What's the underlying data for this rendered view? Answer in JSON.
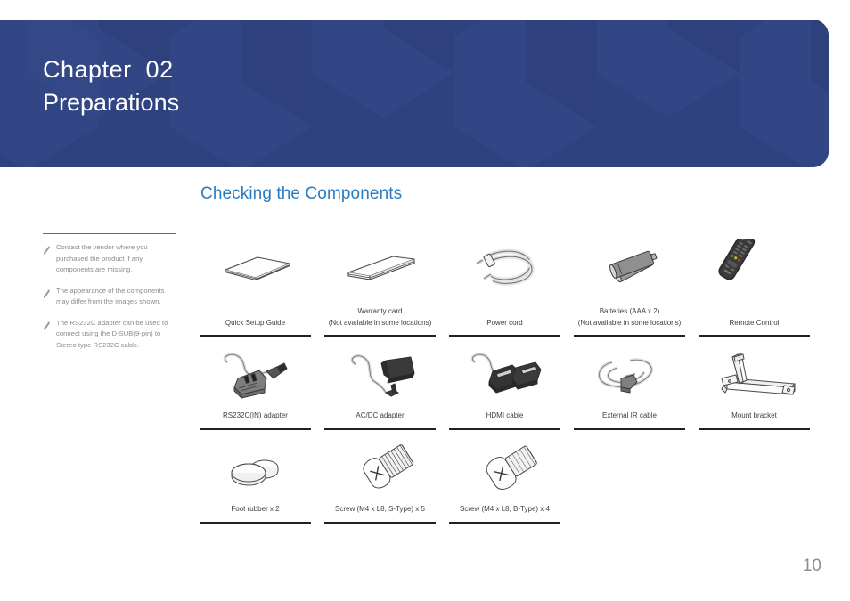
{
  "chapter": {
    "label": "Chapter  02",
    "title": "Preparations",
    "banner_color": "#2f4280"
  },
  "section": {
    "heading": "Checking the Components",
    "heading_color": "#2a7bc0"
  },
  "notes": {
    "icon_name": "pencil-icon",
    "items": [
      "Contact the vendor where you purchased the product if any components are missing.",
      "The appearance of the components may differ from the images shown.",
      "The RS232C adapter can be used to connect using the D-SUB(9-pin) to Stereo type RS232C cable."
    ]
  },
  "components": {
    "rows": [
      [
        {
          "icon": "quick-setup-guide-icon",
          "label": "Quick Setup Guide",
          "sublabel": ""
        },
        {
          "icon": "warranty-card-icon",
          "label": "Warranty card",
          "sublabel": "(Not available in some locations)"
        },
        {
          "icon": "power-cord-icon",
          "label": "Power cord",
          "sublabel": ""
        },
        {
          "icon": "batteries-icon",
          "label": "Batteries (AAA x 2)",
          "sublabel": "(Not available in some locations)"
        },
        {
          "icon": "remote-control-icon",
          "label": "Remote Control",
          "sublabel": ""
        }
      ],
      [
        {
          "icon": "rs232c-adapter-icon",
          "label": "RS232C(IN) adapter",
          "sublabel": ""
        },
        {
          "icon": "ac-dc-adapter-icon",
          "label": "AC/DC adapter",
          "sublabel": ""
        },
        {
          "icon": "hdmi-cable-icon",
          "label": "HDMI cable",
          "sublabel": ""
        },
        {
          "icon": "external-ir-cable-icon",
          "label": "External IR cable",
          "sublabel": ""
        },
        {
          "icon": "mount-bracket-icon",
          "label": "Mount bracket",
          "sublabel": ""
        }
      ],
      [
        {
          "icon": "foot-rubber-icon",
          "label": "Foot rubber x 2",
          "sublabel": ""
        },
        {
          "icon": "screw-s-type-icon",
          "label": "Screw (M4 x L8, S-Type) x 5",
          "sublabel": ""
        },
        {
          "icon": "screw-b-type-icon",
          "label": "Screw (M4 x L8, B-Type) x 4",
          "sublabel": ""
        }
      ]
    ]
  },
  "page": {
    "number": "10"
  }
}
